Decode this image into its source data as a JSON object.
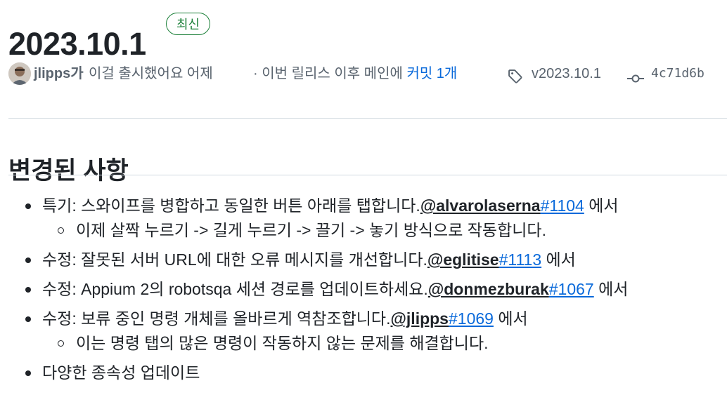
{
  "release": {
    "title": "2023.10.1",
    "badge": "최신"
  },
  "meta": {
    "author": "jlipps가",
    "released_text": "이걸 출시했어요 어제",
    "commits_prefix": "· 이번 릴리스 이후 메인에",
    "commits_link": "커밋 1개",
    "tag": "v2023.10.1",
    "commit_hash": "4c71d6b"
  },
  "changes": {
    "heading": "변경된 사항",
    "items": [
      {
        "text": "특기: 스와이프를 병합하고 동일한 버튼 아래를 탭합니다.",
        "mention": "@alvarolaserna",
        "pr": "#1104",
        "suffix": " 에서",
        "sub": "이제 살짝 누르기 -> 길게 누르기 -> 끌기 -> 놓기 방식으로 작동합니다."
      },
      {
        "text": "수정: 잘못된 서버 URL에 대한 오류 메시지를 개선합니다.",
        "mention": "@eglitise",
        "pr": "#1113",
        "suffix": " 에서"
      },
      {
        "text": "수정: Appium 2의 robotsqa 세션 경로를 업데이트하세요.",
        "mention": "@donmezburak",
        "pr": "#1067",
        "suffix": " 에서"
      },
      {
        "text": "수정: 보류 중인 명령 개체를 올바르게 역참조합니다.",
        "mention": "@jlipps",
        "pr": "#1069",
        "suffix": " 에서",
        "sub": "이는 명령 탭의 많은 명령이 작동하지 않는 문제를 해결합니다."
      },
      {
        "text": "다양한 종속성 업데이트"
      }
    ]
  }
}
